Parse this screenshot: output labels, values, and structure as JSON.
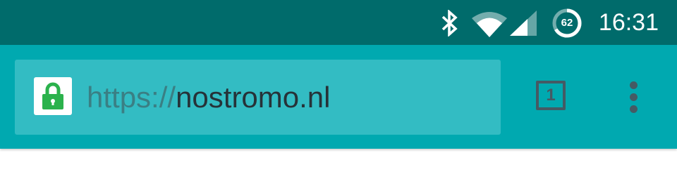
{
  "status_bar": {
    "time": "16:31",
    "battery_level": "62",
    "icons": [
      "bluetooth-icon",
      "wifi-icon",
      "cell-signal-icon",
      "battery-saver-icon"
    ],
    "background": "#006b6b"
  },
  "toolbar": {
    "background": "#00a9b0",
    "url": {
      "scheme": "https://",
      "host": "nostromo.nl",
      "secure": true
    },
    "tab_count": "1",
    "menu_icon": "overflow-menu-icon",
    "lock_color": "#2bb24c"
  }
}
